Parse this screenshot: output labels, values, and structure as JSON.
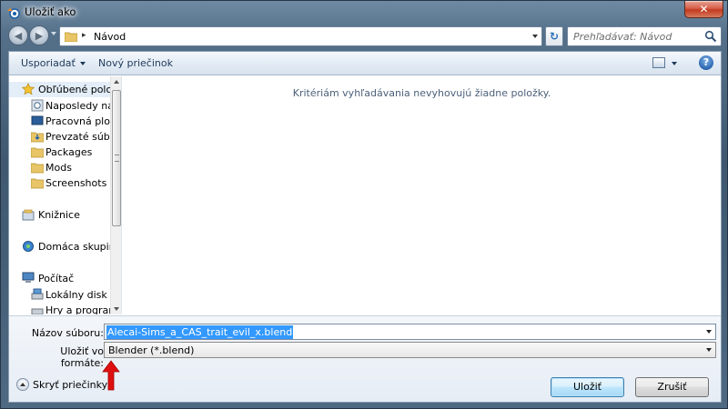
{
  "window": {
    "title": "Uložiť ako",
    "close_glyph": "✕"
  },
  "address": {
    "path_separator": "▸",
    "current_folder": "Návod",
    "refresh_glyph": "↻",
    "search_placeholder": "Prehľadávať: Návod"
  },
  "toolbar": {
    "organize_label": "Usporiadať",
    "new_folder_label": "Nový priečinok",
    "help_glyph": "?"
  },
  "nav": {
    "favorites": {
      "label": "Obľúbené položky",
      "icon": "star-icon"
    },
    "favorite_items": [
      {
        "label": "Naposledy navštívené",
        "icon": "recent-places-icon"
      },
      {
        "label": "Pracovná plocha",
        "icon": "desktop-icon"
      },
      {
        "label": "Prevzaté súbory",
        "icon": "downloads-folder-icon"
      },
      {
        "label": "Packages",
        "icon": "folder-icon"
      },
      {
        "label": "Mods",
        "icon": "folder-icon"
      },
      {
        "label": "Screenshots",
        "icon": "folder-icon"
      }
    ],
    "libraries": {
      "label": "Knižnice",
      "icon": "libraries-icon"
    },
    "homegroup": {
      "label": "Domáca skupina",
      "icon": "homegroup-icon"
    },
    "computer": {
      "label": "Počítač",
      "icon": "computer-icon"
    },
    "computer_items": [
      {
        "label": "Lokálny disk (C:)",
        "icon": "drive-icon"
      },
      {
        "label": "Hry a programy",
        "icon": "drive-icon"
      }
    ]
  },
  "files": {
    "empty_message": "Kritériám vyhľadávania nevyhovujú žiadne položky."
  },
  "form": {
    "filename_label": "Názov súboru:",
    "filename_value": "Alecai-Sims_a_CAS_trait_evil_x.blend",
    "filetype_label": "Uložiť vo formáte:",
    "filetype_value": "Blender (*.blend)"
  },
  "footer": {
    "hide_folders_label": "Skryť priečinky",
    "save_label": "Uložiť",
    "cancel_label": "Zrušiť"
  },
  "colors": {
    "selection": "#3399ff",
    "annotation_arrow": "#e01010",
    "link_blue": "#1e395b"
  }
}
